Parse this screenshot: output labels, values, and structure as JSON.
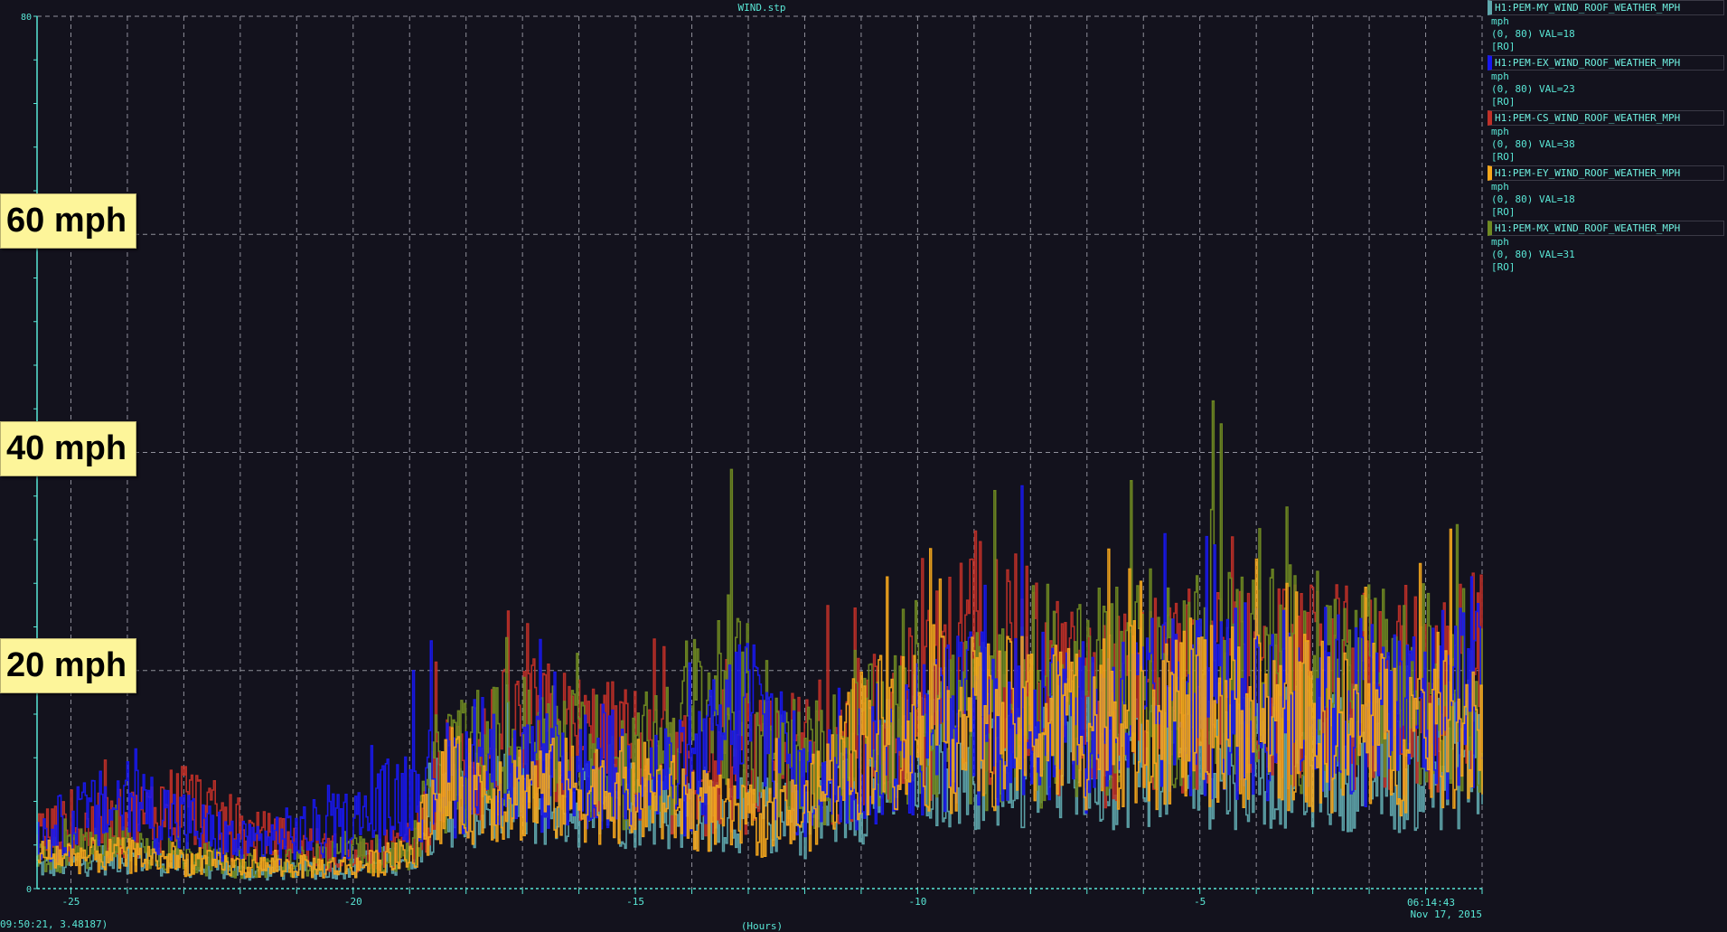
{
  "window_title": "WIND.stp",
  "chart_data": {
    "type": "line",
    "xlabel": "(Hours)",
    "ylim": [
      0,
      80
    ],
    "xlim": [
      -25.6,
      0
    ],
    "x_ticks": [
      -25,
      -20,
      -15,
      -10,
      -5
    ],
    "y_ticks": [
      0,
      80
    ],
    "grid": true,
    "end_time": "06:14:43",
    "end_date": "Nov 17, 2015",
    "series": [
      {
        "name": "H1:PEM-MY_WIND_ROOF_WEATHER_MPH",
        "color": "#5fa8ad",
        "unit": "mph",
        "range": "(0, 80) VAL=18",
        "mode": "[RO]",
        "profile": [
          [
            -25.5,
            2
          ],
          [
            -24,
            3
          ],
          [
            -22,
            1.5
          ],
          [
            -20,
            2
          ],
          [
            -19,
            3
          ],
          [
            -18.5,
            8
          ],
          [
            -15,
            8
          ],
          [
            -13,
            7
          ],
          [
            -12,
            6
          ],
          [
            -10,
            12
          ],
          [
            -8,
            12
          ],
          [
            -6,
            12
          ],
          [
            -3,
            12
          ],
          [
            -1.5,
            11
          ],
          [
            0,
            12
          ]
        ]
      },
      {
        "name": "H1:PEM-EX_WIND_ROOF_WEATHER_MPH",
        "color": "#1818f0",
        "unit": "mph",
        "range": "(0, 80) VAL=23",
        "mode": "[RO]",
        "profile": [
          [
            -25.5,
            5
          ],
          [
            -24,
            8
          ],
          [
            -22,
            4
          ],
          [
            -20,
            6
          ],
          [
            -19,
            9
          ],
          [
            -18.5,
            10
          ],
          [
            -16,
            11
          ],
          [
            -14,
            10
          ],
          [
            -13,
            17
          ],
          [
            -12,
            9
          ],
          [
            -10,
            14
          ],
          [
            -9,
            16
          ],
          [
            -7,
            15
          ],
          [
            -5,
            17
          ],
          [
            -3,
            17
          ],
          [
            -1,
            16
          ],
          [
            0,
            20
          ]
        ]
      },
      {
        "name": "H1:PEM-CS_WIND_ROOF_WEATHER_MPH",
        "color": "#c03028",
        "unit": "mph",
        "range": "(0, 80) VAL=38",
        "mode": "[RO]",
        "profile": [
          [
            -25.5,
            5
          ],
          [
            -24,
            6
          ],
          [
            -23,
            8
          ],
          [
            -22,
            5
          ],
          [
            -20,
            3
          ],
          [
            -19,
            4
          ],
          [
            -18.5,
            10
          ],
          [
            -17,
            14
          ],
          [
            -15,
            12
          ],
          [
            -14,
            10
          ],
          [
            -12,
            12
          ],
          [
            -10,
            16
          ],
          [
            -9,
            22
          ],
          [
            -7,
            16
          ],
          [
            -5,
            18
          ],
          [
            -3,
            18
          ],
          [
            -1,
            18
          ],
          [
            0,
            20
          ]
        ]
      },
      {
        "name": "H1:PEM-EY_WIND_ROOF_WEATHER_MPH",
        "color": "#f6a81c",
        "unit": "mph",
        "range": "(0, 80) VAL=18",
        "mode": "[RO]",
        "profile": [
          [
            -25.5,
            3
          ],
          [
            -24,
            3
          ],
          [
            -22,
            2
          ],
          [
            -20,
            2
          ],
          [
            -19,
            3
          ],
          [
            -18.5,
            9
          ],
          [
            -15,
            9
          ],
          [
            -13,
            6
          ],
          [
            -12,
            7
          ],
          [
            -11,
            14
          ],
          [
            -10,
            15
          ],
          [
            -8,
            15
          ],
          [
            -6,
            16
          ],
          [
            -4,
            16
          ],
          [
            -2,
            14
          ],
          [
            0,
            16
          ]
        ]
      },
      {
        "name": "H1:PEM-MX_WIND_ROOF_WEATHER_MPH",
        "color": "#6f8a22",
        "unit": "mph",
        "range": "(0, 80) VAL=31",
        "mode": "[RO]",
        "profile": [
          [
            -25.5,
            3
          ],
          [
            -24,
            4
          ],
          [
            -22,
            2
          ],
          [
            -20,
            3
          ],
          [
            -19,
            3
          ],
          [
            -18.5,
            11
          ],
          [
            -17,
            13
          ],
          [
            -15,
            11
          ],
          [
            -13.5,
            18
          ],
          [
            -12,
            11
          ],
          [
            -10,
            15
          ],
          [
            -8,
            16
          ],
          [
            -6,
            19
          ],
          [
            -4,
            20
          ],
          [
            -2,
            18
          ],
          [
            0,
            18
          ]
        ]
      }
    ]
  },
  "callouts": [
    "60 mph",
    "40 mph",
    "20 mph"
  ],
  "status_readout": "09:50:21, 3.48187)"
}
